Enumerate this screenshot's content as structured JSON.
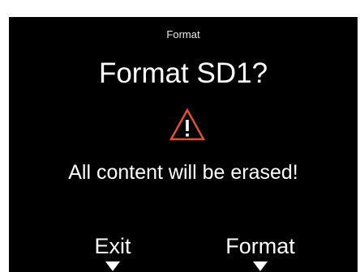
{
  "screen": {
    "menu_title": "Format",
    "question": "Format SD1?",
    "warning_icon": "warning-triangle-icon",
    "warning_color": "#e0522b",
    "message": "All content will be erased!"
  },
  "softkeys": {
    "left_label": "Exit",
    "right_label": "Format",
    "arrow_icon": "down-triangle-icon"
  }
}
